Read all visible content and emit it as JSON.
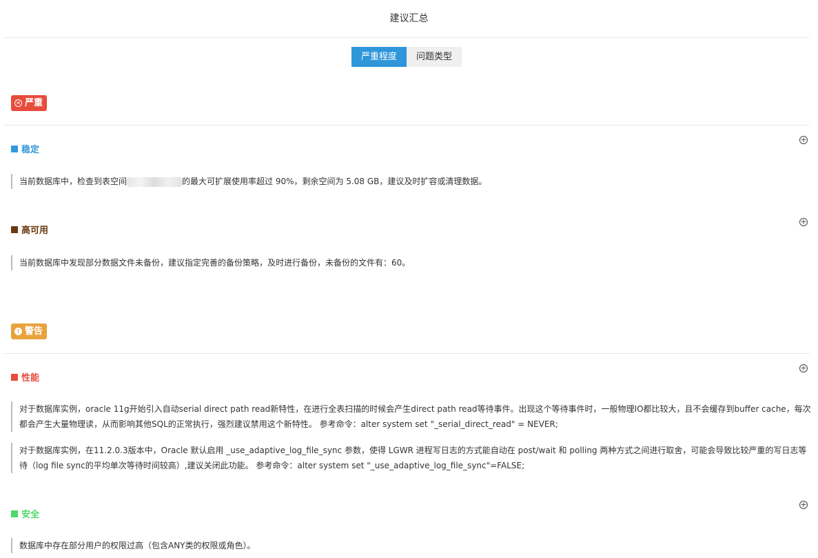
{
  "page": {
    "title": "建议汇总"
  },
  "tabs": [
    {
      "label": "严重程度",
      "active": true
    },
    {
      "label": "问题类型",
      "active": false
    }
  ],
  "colors": {
    "accent": "#2e96d9",
    "severe": "#e74c3c",
    "warning": "#e8a33c",
    "stable": "#3498db",
    "ha": "#6b3a10",
    "perf": "#e74c3c",
    "security": "#4cd964"
  },
  "groups": [
    {
      "badge": "严重",
      "icon": "close-circle-icon",
      "categories": [
        {
          "name": "稳定",
          "items": [
            {
              "before": "当前数据库中，检查到表空间",
              "after": "的最大可扩展使用率超过 90%，剩余空间为 5.08 GB，建议及时扩容或清理数据。"
            }
          ]
        },
        {
          "name": "高可用",
          "items": [
            {
              "text": "当前数据库中发现部分数据文件未备份，建议指定完善的备份策略，及时进行备份，未备份的文件有：60。"
            }
          ]
        }
      ]
    },
    {
      "badge": "警告",
      "icon": "exclamation-circle-icon",
      "categories": [
        {
          "name": "性能",
          "items": [
            {
              "text": "对于数据库实例，oracle 11g开始引入自动serial direct path read新特性，在进行全表扫描的时候会产生direct path read等待事件。出现这个等待事件时，一般物理IO都比较大，且不会缓存到buffer cache，每次都会产生大量物理读，从而影响其他SQL的正常执行，强烈建议禁用这个新特性。 参考命令：alter system set \"_serial_direct_read\" = NEVER;"
            },
            {
              "text": "对于数据库实例，在11.2.0.3版本中，Oracle 默认启用 _use_adaptive_log_file_sync 参数，使得 LGWR 进程写日志的方式能自动在 post/wait 和 polling 两种方式之间进行取舍，可能会导致比较严重的写日志等待（log file sync的平均单次等待时间较高）,建议关闭此功能。 参考命令：alter system set \"_use_adaptive_log_file_sync\"=FALSE;"
            }
          ]
        },
        {
          "name": "安全",
          "items": [
            {
              "text": "数据库中存在部分用户的权限过高（包含ANY类的权限或角色）。"
            }
          ]
        }
      ]
    }
  ],
  "expand_symbol": "+"
}
